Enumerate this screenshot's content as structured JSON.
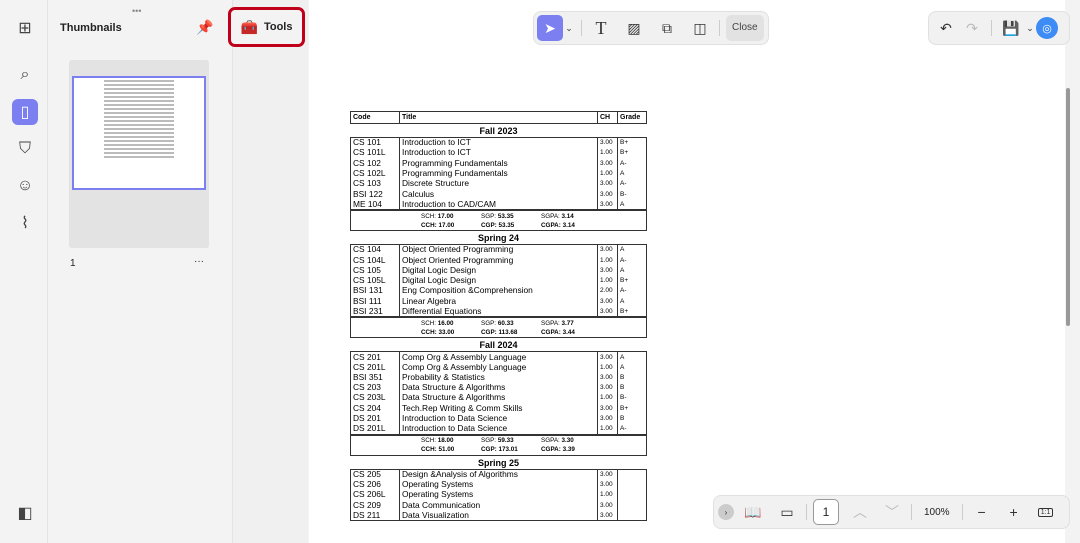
{
  "sidebar": {
    "title": "Thumbnails",
    "page_label": "1",
    "more": "···"
  },
  "tools_button": "Tools",
  "toolbar": {
    "close": "Close"
  },
  "bottom": {
    "page": "1",
    "zoom": "100%",
    "fit": "1:1"
  },
  "transcript": {
    "headers": [
      "Code",
      "Title",
      "CH",
      "Grade"
    ],
    "semesters": [
      {
        "name": "Fall 2023",
        "rows": [
          [
            "CS  101",
            "Introduction to ICT",
            "3.00",
            "B+"
          ],
          [
            "CS  101L",
            "Introduction to ICT",
            "1.00",
            "B+"
          ],
          [
            "CS  102",
            "Programming Fundamentals",
            "3.00",
            "A-"
          ],
          [
            "CS  102L",
            "Programming Fundamentals",
            "1.00",
            "A"
          ],
          [
            "CS  103",
            "Discrete Structure",
            "3.00",
            "A-"
          ],
          [
            "BSI  122",
            "Calculus",
            "3.00",
            "B-"
          ],
          [
            "ME  104",
            "Introduction to CAD/CAM",
            "3.00",
            "A"
          ]
        ],
        "summary": {
          "sch": "17.00",
          "sgp": "53.35",
          "sgpa": "3.14",
          "cch": "17.00",
          "cgp": "53.35",
          "cgpa": "3.14"
        }
      },
      {
        "name": "Spring 24",
        "rows": [
          [
            "CS  104",
            "Object Oriented Programming",
            "3.00",
            "A"
          ],
          [
            "CS  104L",
            "Object Oriented Programming",
            "1.00",
            "A-"
          ],
          [
            "CS  105",
            "Digital Logic Design",
            "3.00",
            "A"
          ],
          [
            "CS  105L",
            "Digital Logic Design",
            "1.00",
            "B+"
          ],
          [
            "BSI  131",
            "Eng Composition &Comprehension",
            "2.00",
            "A-"
          ],
          [
            "BSI  111",
            "Linear Algebra",
            "3.00",
            "A"
          ],
          [
            "BSI  231",
            "Differential Equations",
            "3.00",
            "B+"
          ]
        ],
        "summary": {
          "sch": "16.00",
          "sgp": "60.33",
          "sgpa": "3.77",
          "cch": "33.00",
          "cgp": "113.68",
          "cgpa": "3.44"
        }
      },
      {
        "name": "Fall 2024",
        "rows": [
          [
            "CS  201",
            "Comp Org & Assembly Language",
            "3.00",
            "A"
          ],
          [
            "CS  201L",
            "Comp Org & Assembly Language",
            "1.00",
            "A"
          ],
          [
            "BSI  351",
            "Probability & Statistics",
            "3.00",
            "B"
          ],
          [
            "CS  203",
            "Data Structure & Algorithms",
            "3.00",
            "B"
          ],
          [
            "CS  203L",
            "Data Structure & Algorithms",
            "1.00",
            "B-"
          ],
          [
            "CS  204",
            "Tech.Rep Writing & Comm Skills",
            "3.00",
            "B+"
          ],
          [
            "DS  201",
            "Introduction to Data Science",
            "3.00",
            "B"
          ],
          [
            "DS  201L",
            "Introduction to Data Science",
            "1.00",
            "A-"
          ]
        ],
        "summary": {
          "sch": "18.00",
          "sgp": "59.33",
          "sgpa": "3.30",
          "cch": "51.00",
          "cgp": "173.01",
          "cgpa": "3.39"
        }
      },
      {
        "name": "Spring 25",
        "rows": [
          [
            "CS  205",
            "Design &Analysis of Algorithms",
            "3.00",
            ""
          ],
          [
            "CS  206",
            "Operating Systems",
            "3.00",
            ""
          ],
          [
            "CS  206L",
            "Operating Systems",
            "1.00",
            ""
          ],
          [
            "CS  209",
            "Data Communication",
            "3.00",
            ""
          ],
          [
            "DS  211",
            "Data Visualization",
            "3.00",
            ""
          ]
        ]
      }
    ],
    "summary_labels": {
      "sch": "SCH:",
      "sgp": "SGP:",
      "sgpa": "SGPA:",
      "cch": "CCH:",
      "cgp": "CGP:",
      "cgpa": "CGPA:"
    }
  }
}
